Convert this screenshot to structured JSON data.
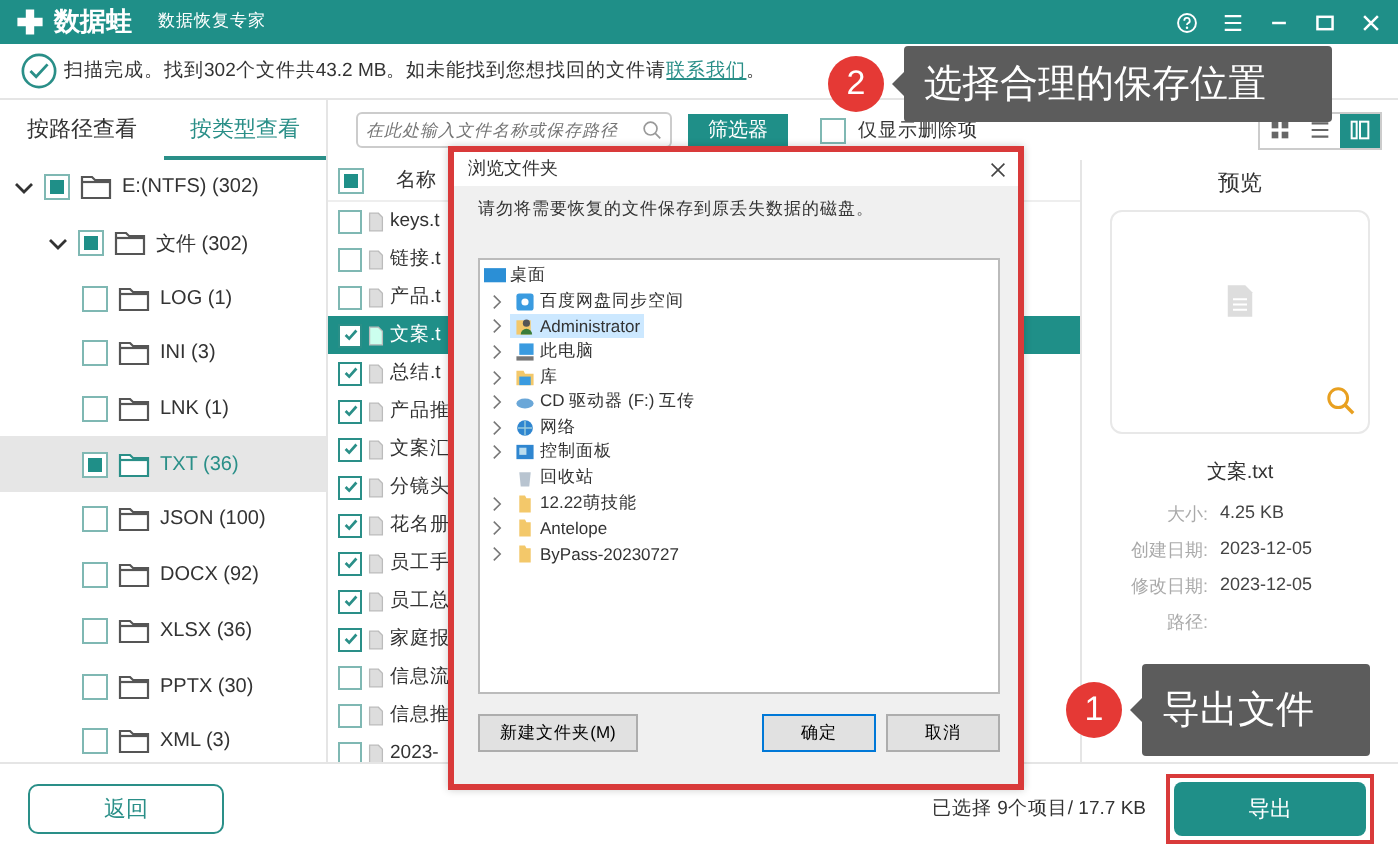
{
  "header": {
    "logo": "数据蛙",
    "subtitle": "数据恢复专家"
  },
  "info": {
    "before": "扫描完成。找到302个文件共43.2 MB。如未能找到您想找回的文件请",
    "link": "联系我们",
    "after": "。"
  },
  "view_tabs": [
    {
      "label": "按路径查看",
      "selected": false
    },
    {
      "label": "按类型查看",
      "selected": true
    }
  ],
  "tree": [
    {
      "label": "E:(NTFS) (302)",
      "partial": true,
      "selected": false,
      "expanded": true,
      "children": [
        {
          "label": "文件 (302)",
          "partial": true,
          "selected": false,
          "expanded": true,
          "children": [
            {
              "label": "LOG (1)",
              "partial": false,
              "selected": false
            },
            {
              "label": "INI (3)",
              "partial": false,
              "selected": false
            },
            {
              "label": "LNK (1)",
              "partial": false,
              "selected": false
            },
            {
              "label": "TXT (36)",
              "partial": true,
              "selected": true
            },
            {
              "label": "JSON (100)",
              "partial": false,
              "selected": false
            },
            {
              "label": "DOCX (92)",
              "partial": false,
              "selected": false
            },
            {
              "label": "XLSX (36)",
              "partial": false,
              "selected": false
            },
            {
              "label": "PPTX (30)",
              "partial": false,
              "selected": false
            },
            {
              "label": "XML (3)",
              "partial": false,
              "selected": false
            }
          ]
        }
      ]
    }
  ],
  "search": {
    "placeholder": "在此处输入文件名称或保存路径"
  },
  "filter_button": "筛选器",
  "deleted_only": {
    "label": "仅显示删除项",
    "checked": false
  },
  "view_modes": [
    {
      "kind": "grid",
      "selected": false
    },
    {
      "kind": "list",
      "selected": false
    },
    {
      "kind": "detail",
      "selected": true
    }
  ],
  "list": {
    "header_checked": true,
    "column": "名称",
    "rows": [
      {
        "name": "keys.t",
        "checked": false,
        "selected": false
      },
      {
        "name": "链接.t",
        "checked": false,
        "selected": false
      },
      {
        "name": "产品.t",
        "checked": false,
        "selected": false
      },
      {
        "name": "文案.t",
        "checked": true,
        "selected": true
      },
      {
        "name": "总结.t",
        "checked": true,
        "selected": false
      },
      {
        "name": "产品推",
        "checked": true,
        "selected": false
      },
      {
        "name": "文案汇",
        "checked": true,
        "selected": false
      },
      {
        "name": "分镜头",
        "checked": true,
        "selected": false
      },
      {
        "name": "花名册",
        "checked": true,
        "selected": false
      },
      {
        "name": "员工手",
        "checked": true,
        "selected": false
      },
      {
        "name": "员工总",
        "checked": true,
        "selected": false
      },
      {
        "name": "家庭报",
        "checked": true,
        "selected": false
      },
      {
        "name": "信息流",
        "checked": false,
        "selected": false
      },
      {
        "name": "信息推",
        "checked": false,
        "selected": false
      },
      {
        "name": "2023-",
        "checked": false,
        "selected": false
      }
    ]
  },
  "preview": {
    "title": "预览",
    "file_name": "文案.txt",
    "details": [
      {
        "label": "大小:",
        "value": "4.25 KB"
      },
      {
        "label": "创建日期:",
        "value": "2023-12-05"
      },
      {
        "label": "修改日期:",
        "value": "2023-12-05"
      },
      {
        "label": "路径:"
      }
    ]
  },
  "dialog": {
    "title": "浏览文件夹",
    "message": "请勿将需要恢复的文件保存到原丢失数据的磁盘。",
    "root": "桌面",
    "items": [
      {
        "label": "百度网盘同步空间",
        "kind": "cloud",
        "has_children": true,
        "selected": false
      },
      {
        "label": "Administrator",
        "kind": "user",
        "has_children": true,
        "selected": true
      },
      {
        "label": "此电脑",
        "kind": "pc",
        "has_children": true,
        "selected": false
      },
      {
        "label": "库",
        "kind": "library",
        "has_children": true,
        "selected": false
      },
      {
        "label": "CD 驱动器 (F:) 互传",
        "kind": "drive",
        "has_children": true,
        "selected": false
      },
      {
        "label": "网络",
        "kind": "network",
        "has_children": true,
        "selected": false
      },
      {
        "label": "控制面板",
        "kind": "panel",
        "has_children": true,
        "selected": false
      },
      {
        "label": "回收站",
        "kind": "bin",
        "has_children": false,
        "selected": false
      },
      {
        "label": "12.22萌技能",
        "kind": "folder",
        "has_children": true,
        "selected": false
      },
      {
        "label": "Antelope",
        "kind": "folder",
        "has_children": true,
        "selected": false
      },
      {
        "label": "ByPass-20230727",
        "kind": "folder",
        "has_children": true,
        "selected": false
      }
    ],
    "new_folder": "新建文件夹(M)",
    "ok": "确定",
    "cancel": "取消"
  },
  "back_button": "返回",
  "status": "已选择 9个项目/ 17.7 KB",
  "export_button": "导出",
  "callouts": [
    {
      "number": "2",
      "text": "选择合理的保存位置"
    },
    {
      "number": "1",
      "text": "导出文件"
    }
  ]
}
